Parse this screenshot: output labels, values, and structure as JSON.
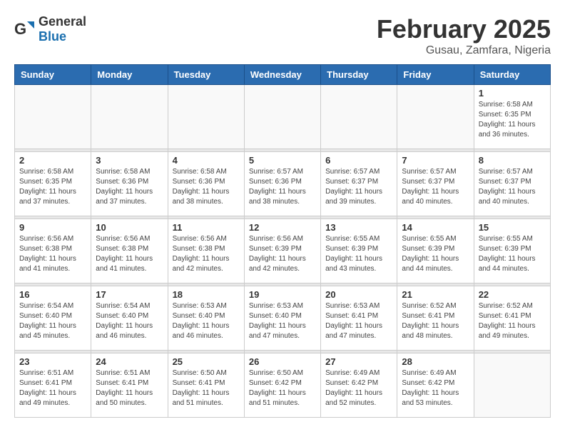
{
  "header": {
    "logo_general": "General",
    "logo_blue": "Blue",
    "month_title": "February 2025",
    "location": "Gusau, Zamfara, Nigeria"
  },
  "weekdays": [
    "Sunday",
    "Monday",
    "Tuesday",
    "Wednesday",
    "Thursday",
    "Friday",
    "Saturday"
  ],
  "weeks": [
    [
      {
        "day": "",
        "info": ""
      },
      {
        "day": "",
        "info": ""
      },
      {
        "day": "",
        "info": ""
      },
      {
        "day": "",
        "info": ""
      },
      {
        "day": "",
        "info": ""
      },
      {
        "day": "",
        "info": ""
      },
      {
        "day": "1",
        "info": "Sunrise: 6:58 AM\nSunset: 6:35 PM\nDaylight: 11 hours\nand 36 minutes."
      }
    ],
    [
      {
        "day": "2",
        "info": "Sunrise: 6:58 AM\nSunset: 6:35 PM\nDaylight: 11 hours\nand 37 minutes."
      },
      {
        "day": "3",
        "info": "Sunrise: 6:58 AM\nSunset: 6:36 PM\nDaylight: 11 hours\nand 37 minutes."
      },
      {
        "day": "4",
        "info": "Sunrise: 6:58 AM\nSunset: 6:36 PM\nDaylight: 11 hours\nand 38 minutes."
      },
      {
        "day": "5",
        "info": "Sunrise: 6:57 AM\nSunset: 6:36 PM\nDaylight: 11 hours\nand 38 minutes."
      },
      {
        "day": "6",
        "info": "Sunrise: 6:57 AM\nSunset: 6:37 PM\nDaylight: 11 hours\nand 39 minutes."
      },
      {
        "day": "7",
        "info": "Sunrise: 6:57 AM\nSunset: 6:37 PM\nDaylight: 11 hours\nand 40 minutes."
      },
      {
        "day": "8",
        "info": "Sunrise: 6:57 AM\nSunset: 6:37 PM\nDaylight: 11 hours\nand 40 minutes."
      }
    ],
    [
      {
        "day": "9",
        "info": "Sunrise: 6:56 AM\nSunset: 6:38 PM\nDaylight: 11 hours\nand 41 minutes."
      },
      {
        "day": "10",
        "info": "Sunrise: 6:56 AM\nSunset: 6:38 PM\nDaylight: 11 hours\nand 41 minutes."
      },
      {
        "day": "11",
        "info": "Sunrise: 6:56 AM\nSunset: 6:38 PM\nDaylight: 11 hours\nand 42 minutes."
      },
      {
        "day": "12",
        "info": "Sunrise: 6:56 AM\nSunset: 6:39 PM\nDaylight: 11 hours\nand 42 minutes."
      },
      {
        "day": "13",
        "info": "Sunrise: 6:55 AM\nSunset: 6:39 PM\nDaylight: 11 hours\nand 43 minutes."
      },
      {
        "day": "14",
        "info": "Sunrise: 6:55 AM\nSunset: 6:39 PM\nDaylight: 11 hours\nand 44 minutes."
      },
      {
        "day": "15",
        "info": "Sunrise: 6:55 AM\nSunset: 6:39 PM\nDaylight: 11 hours\nand 44 minutes."
      }
    ],
    [
      {
        "day": "16",
        "info": "Sunrise: 6:54 AM\nSunset: 6:40 PM\nDaylight: 11 hours\nand 45 minutes."
      },
      {
        "day": "17",
        "info": "Sunrise: 6:54 AM\nSunset: 6:40 PM\nDaylight: 11 hours\nand 46 minutes."
      },
      {
        "day": "18",
        "info": "Sunrise: 6:53 AM\nSunset: 6:40 PM\nDaylight: 11 hours\nand 46 minutes."
      },
      {
        "day": "19",
        "info": "Sunrise: 6:53 AM\nSunset: 6:40 PM\nDaylight: 11 hours\nand 47 minutes."
      },
      {
        "day": "20",
        "info": "Sunrise: 6:53 AM\nSunset: 6:41 PM\nDaylight: 11 hours\nand 47 minutes."
      },
      {
        "day": "21",
        "info": "Sunrise: 6:52 AM\nSunset: 6:41 PM\nDaylight: 11 hours\nand 48 minutes."
      },
      {
        "day": "22",
        "info": "Sunrise: 6:52 AM\nSunset: 6:41 PM\nDaylight: 11 hours\nand 49 minutes."
      }
    ],
    [
      {
        "day": "23",
        "info": "Sunrise: 6:51 AM\nSunset: 6:41 PM\nDaylight: 11 hours\nand 49 minutes."
      },
      {
        "day": "24",
        "info": "Sunrise: 6:51 AM\nSunset: 6:41 PM\nDaylight: 11 hours\nand 50 minutes."
      },
      {
        "day": "25",
        "info": "Sunrise: 6:50 AM\nSunset: 6:41 PM\nDaylight: 11 hours\nand 51 minutes."
      },
      {
        "day": "26",
        "info": "Sunrise: 6:50 AM\nSunset: 6:42 PM\nDaylight: 11 hours\nand 51 minutes."
      },
      {
        "day": "27",
        "info": "Sunrise: 6:49 AM\nSunset: 6:42 PM\nDaylight: 11 hours\nand 52 minutes."
      },
      {
        "day": "28",
        "info": "Sunrise: 6:49 AM\nSunset: 6:42 PM\nDaylight: 11 hours\nand 53 minutes."
      },
      {
        "day": "",
        "info": ""
      }
    ]
  ]
}
